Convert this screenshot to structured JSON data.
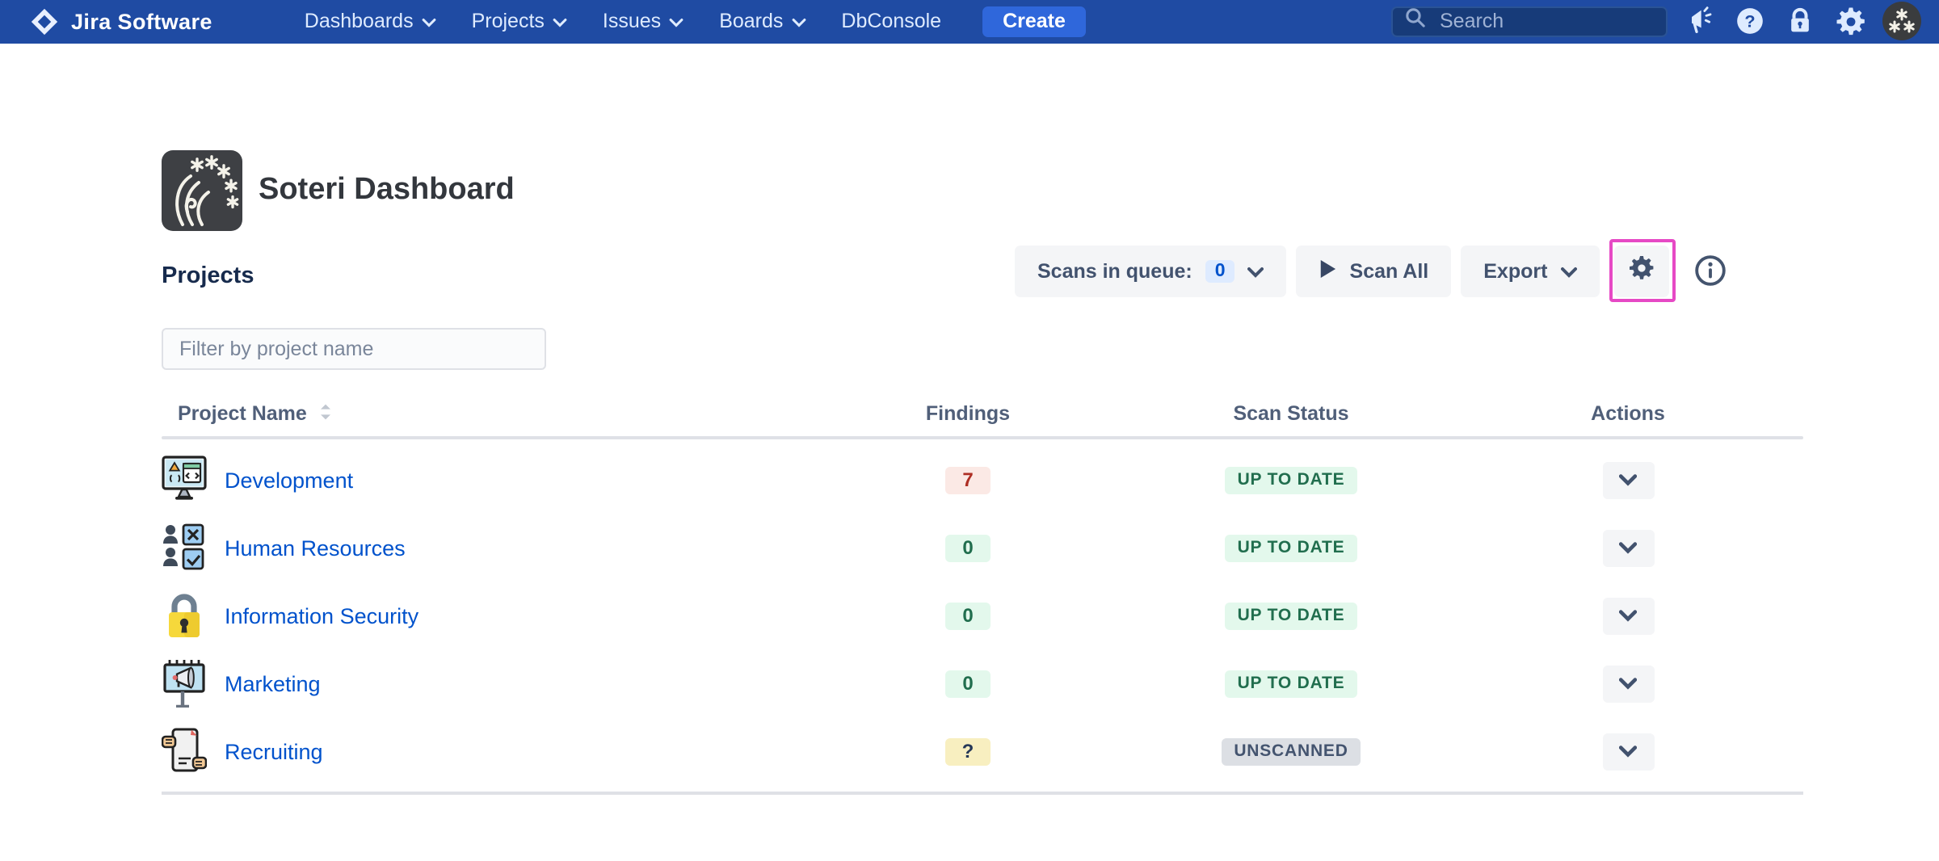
{
  "nav": {
    "brand": "Jira Software",
    "items": [
      {
        "label": "Dashboards",
        "has_dropdown": true
      },
      {
        "label": "Projects",
        "has_dropdown": true
      },
      {
        "label": "Issues",
        "has_dropdown": true
      },
      {
        "label": "Boards",
        "has_dropdown": true
      },
      {
        "label": "DbConsole",
        "has_dropdown": false
      }
    ],
    "create_label": "Create",
    "search_placeholder": "Search",
    "icons": [
      "announcement-icon",
      "help-icon",
      "lock-icon",
      "settings-icon",
      "user-avatar"
    ]
  },
  "header": {
    "title": "Soteri Dashboard",
    "logo": "soteri-logo"
  },
  "projects": {
    "heading": "Projects",
    "filter_placeholder": "Filter by project name",
    "table": {
      "columns": [
        "Project Name",
        "Findings",
        "Scan Status",
        "Actions"
      ],
      "rows": [
        {
          "name": "Development",
          "icon": "monitor-code-icon",
          "findings": "7",
          "findings_type": "danger",
          "status": "UP TO DATE",
          "status_type": "success"
        },
        {
          "name": "Human Resources",
          "icon": "people-checklist-icon",
          "findings": "0",
          "findings_type": "success",
          "status": "UP TO DATE",
          "status_type": "success"
        },
        {
          "name": "Information Security",
          "icon": "padlock-icon",
          "findings": "0",
          "findings_type": "success",
          "status": "UP TO DATE",
          "status_type": "success"
        },
        {
          "name": "Marketing",
          "icon": "billboard-megaphone-icon",
          "findings": "0",
          "findings_type": "success",
          "status": "UP TO DATE",
          "status_type": "success"
        },
        {
          "name": "Recruiting",
          "icon": "resume-hands-icon",
          "findings": "?",
          "findings_type": "warning",
          "status": "UNSCANNED",
          "status_type": "neutral"
        }
      ]
    }
  },
  "toolbar": {
    "scans_in_queue_label": "Scans in queue:",
    "scans_in_queue_count": "0",
    "scan_all_label": "Scan All",
    "export_label": "Export"
  },
  "colors": {
    "nav_background": "#1F4BA3",
    "create_button": "#2F67DB",
    "link": "#0052CC",
    "highlight_pink": "#E649C5",
    "badge_danger_bg": "#FBE9E5",
    "badge_danger_text": "#AE2E24",
    "badge_success_bg": "#E3F8EC",
    "badge_success_text": "#216E4E",
    "badge_warning_bg": "#F8EFC0",
    "badge_neutral_bg": "#DCDFE4",
    "badge_neutral_text": "#44546F",
    "queue_chip_bg": "#DEEBFF",
    "queue_chip_text": "#0052CC"
  }
}
